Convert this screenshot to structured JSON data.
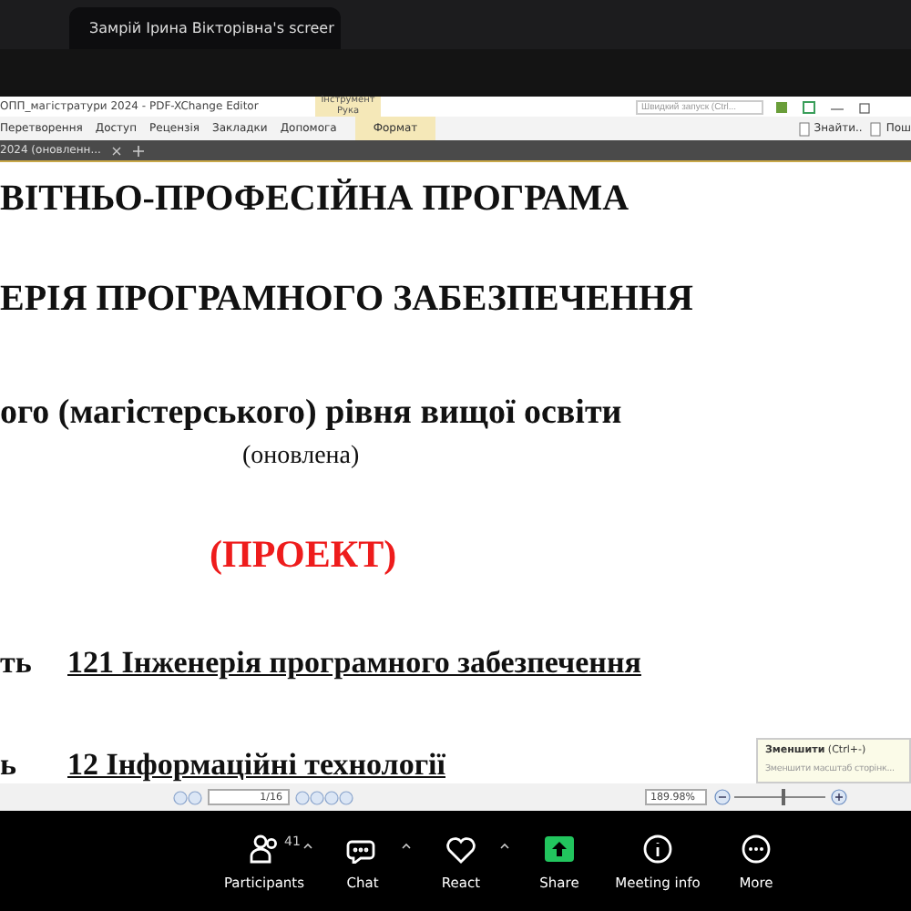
{
  "share_tab": {
    "title": "Замрій Ірина Вікторівна's screer"
  },
  "editor": {
    "title": "ОПП_магістратури 2024 - PDF-XChange Editor",
    "tool_label": "Інструмент Рука",
    "quick_launch": {
      "placeholder": "Швидкий запуск (Ctrl..."
    },
    "menu": [
      {
        "label": "Перетворення",
        "contextual": false
      },
      {
        "label": "Доступ",
        "contextual": false
      },
      {
        "label": "Рецензія",
        "contextual": false
      },
      {
        "label": "Закладки",
        "contextual": false
      },
      {
        "label": "Допомога",
        "contextual": false
      },
      {
        "label": "Формат",
        "contextual": true
      }
    ],
    "right_tools": [
      "Знайти..",
      "Пош"
    ],
    "doc_tab": "2024 (оновленн..."
  },
  "document": {
    "lines": [
      {
        "kind": "heading",
        "text": "ВІТНЬО-ПРОФЕСІЙНА ПРОГРАМА"
      },
      {
        "kind": "heading",
        "text": "ЕРІЯ ПРОГРАМНОГО ЗАБЕЗПЕЧЕННЯ"
      },
      {
        "kind": "subheading",
        "text": "ого (магістерського) рівня вищої освіти"
      },
      {
        "kind": "note",
        "text": "(оновлена)"
      },
      {
        "kind": "draft",
        "text": "(ПРОЕКТ)"
      },
      {
        "kind": "field",
        "label": "ть",
        "text": "121 Інженерія програмного забезпечення"
      },
      {
        "kind": "field",
        "label": "ь",
        "text": "12  Інформаційні технології"
      }
    ]
  },
  "status_bar": {
    "page": "1/16",
    "zoom": "189.98%",
    "level": 0.52
  },
  "tooltip": {
    "title": "Зменшити",
    "shortcut": "(Ctrl+-)",
    "text": "Зменшити масштаб сторінк..."
  },
  "toolbar": [
    {
      "kind": "participants",
      "label": "Participants",
      "count": "41",
      "has_menu": true
    },
    {
      "kind": "chat",
      "label": "Chat",
      "has_menu": true
    },
    {
      "kind": "react",
      "label": "React",
      "has_menu": true
    },
    {
      "kind": "share",
      "label": "Share",
      "has_menu": false
    },
    {
      "kind": "info",
      "label": "Meeting info",
      "has_menu": false
    },
    {
      "kind": "more",
      "label": "More",
      "has_menu": false
    }
  ]
}
